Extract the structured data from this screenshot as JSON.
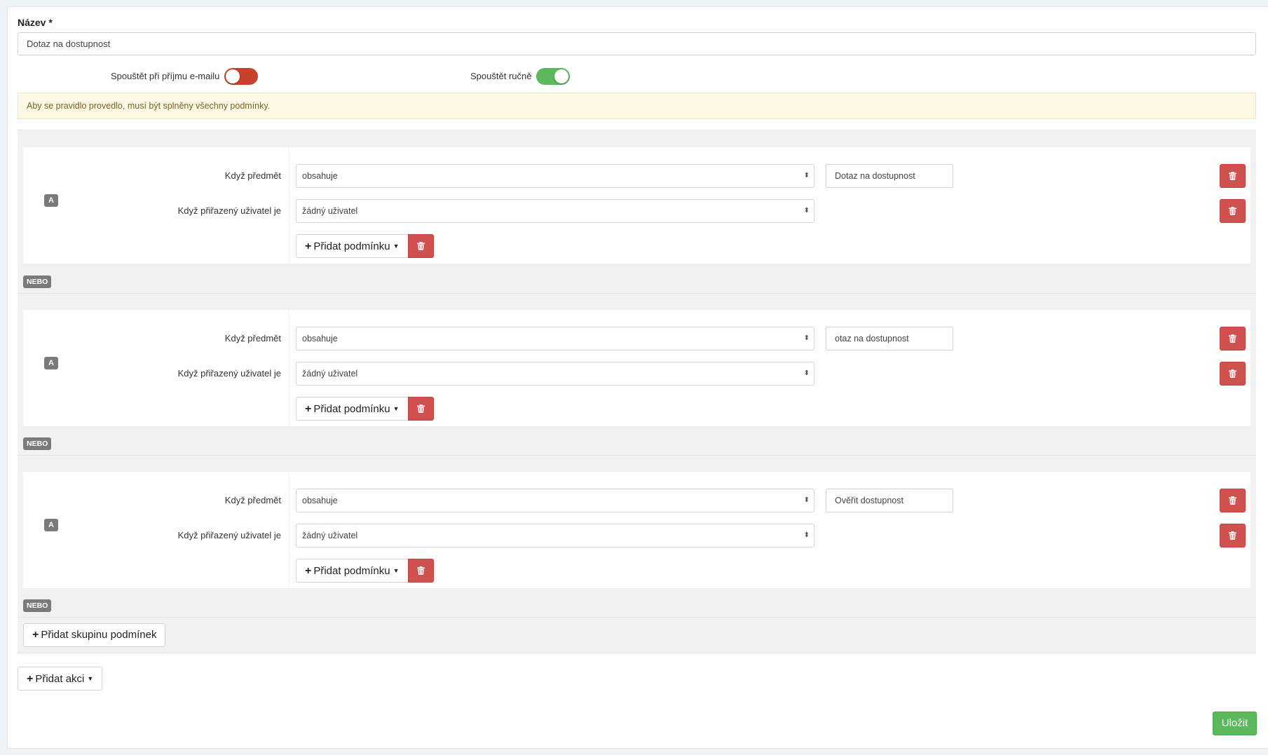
{
  "form": {
    "name_label": "Název",
    "required_mark": "*",
    "name_value": "Dotaz na dostupnost",
    "toggle_email": {
      "label": "Spouštět při příjmu e-mailu",
      "state": "off",
      "color": "#c9412b"
    },
    "toggle_manual": {
      "label": "Spouštět ručně",
      "state": "on",
      "color": "#5cb85c"
    },
    "notice": "Aby se pravidlo provedlo, musí být splněny všechny podmínky."
  },
  "groups": [
    {
      "badge": "A",
      "rows": [
        {
          "label": "Když předmět",
          "operator": "obsahuje",
          "value": "Dotaz na dostupnost"
        },
        {
          "label": "Když přiřazený uživatel je",
          "operator": "žádný uživatel",
          "value": ""
        }
      ],
      "add_condition": "Přidat podmínku"
    },
    {
      "badge": "A",
      "rows": [
        {
          "label": "Když předmět",
          "operator": "obsahuje",
          "value": "otaz na dostupnost"
        },
        {
          "label": "Když přiřazený uživatel je",
          "operator": "žádný uživatel",
          "value": ""
        }
      ],
      "add_condition": "Přidat podmínku"
    },
    {
      "badge": "A",
      "rows": [
        {
          "label": "Když předmět",
          "operator": "obsahuje",
          "value": "Ověřit dostupnost"
        },
        {
          "label": "Když přiřazený uživatel je",
          "operator": "žádný uživatel",
          "value": ""
        }
      ],
      "add_condition": "Přidat podmínku"
    }
  ],
  "or_label": "NEBO",
  "add_group": "Přidat skupinu podmínek",
  "add_action": "Přidat akci",
  "save": "Uložit",
  "icons": {
    "plus": "plus-icon",
    "trash": "trash-icon",
    "caret": "caret-down-icon",
    "select_arrows": "select-arrows-icon"
  },
  "colors": {
    "danger": "#d05250",
    "success": "#5cb85c",
    "notice_bg": "#fcf8e3",
    "badge": "#7a7a7a"
  }
}
